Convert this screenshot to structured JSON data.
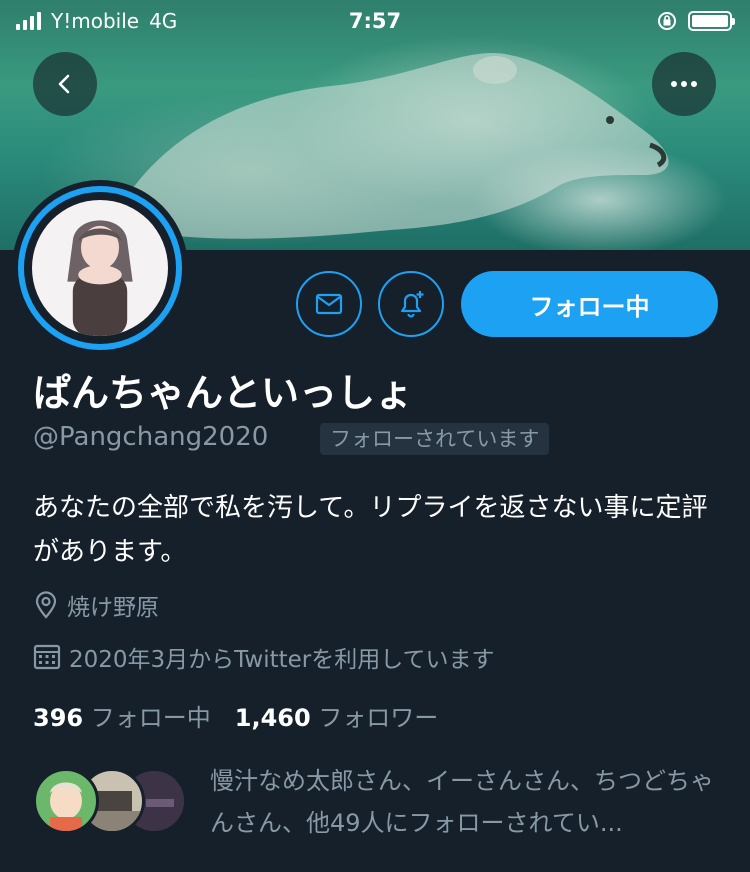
{
  "status_bar": {
    "carrier": "Y!mobile",
    "network": "4G",
    "time": "7:57"
  },
  "profile": {
    "display_name": "ぱんちゃんといっしょ",
    "handle": "@Pangchang2020",
    "follows_you_badge": "フォローされています",
    "bio": "あなたの全部で私を汚して。リプライを返さない事に定評があります。",
    "location": "焼け野原",
    "joined": "2020年3月からTwitterを利用しています",
    "following_count": "396",
    "following_label": "フォロー中",
    "followers_count": "1,460",
    "followers_label": "フォロワー",
    "followed_by_text": "慢汁なめ太郎さん、イーさんさん、ちつどちゃんさん、他49人にフォローされてい..."
  },
  "actions": {
    "follow_button_label": "フォロー中",
    "message_icon": "mail-icon",
    "notify_icon": "bell-plus-icon",
    "back_icon": "chevron-left-icon",
    "more_icon": "more-dots-icon"
  },
  "colors": {
    "background": "#15202b",
    "accent": "#1da1f2",
    "muted_text": "#8899a6"
  }
}
